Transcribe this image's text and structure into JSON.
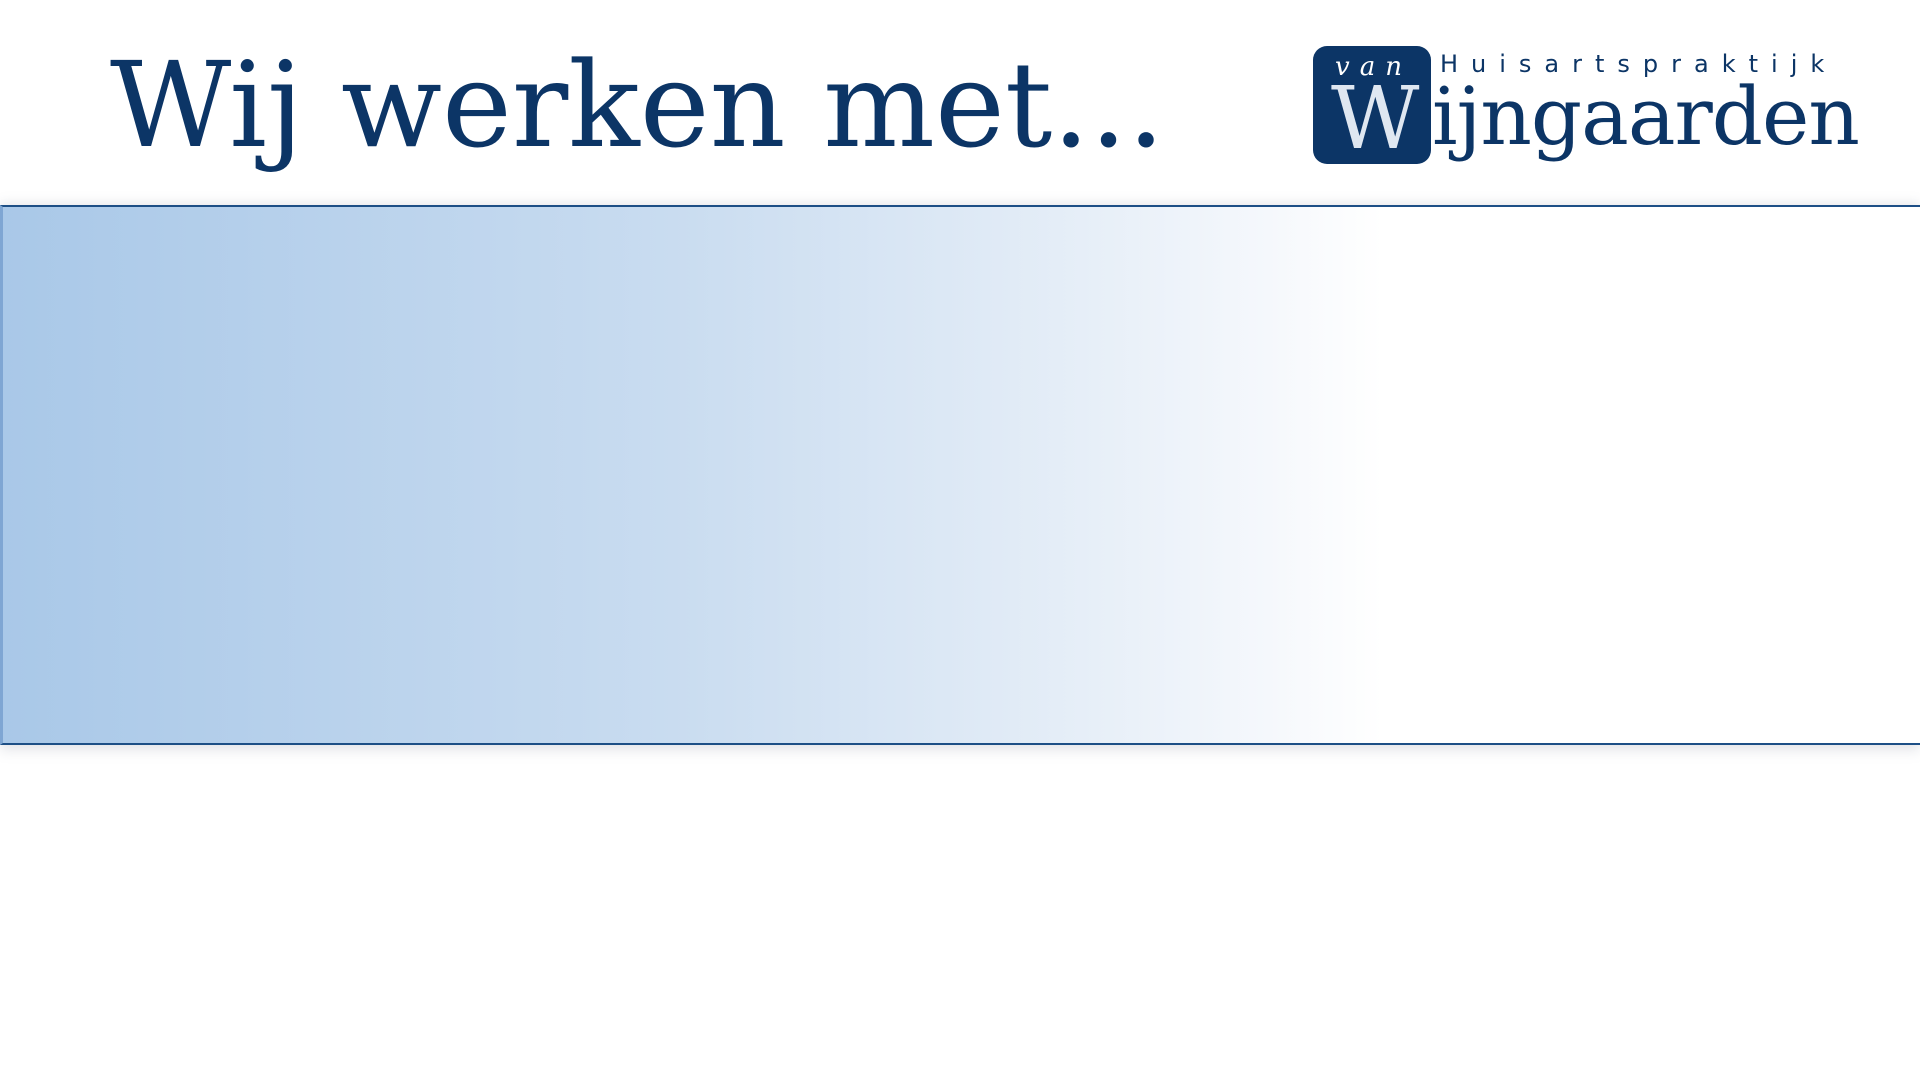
{
  "slide": {
    "title": "Wij werken met..."
  },
  "logo": {
    "prefix": "van",
    "tagline": "Huisartspraktijk",
    "initial": "W",
    "name_rest": "ijngaarden",
    "full_name": "van Wijngaarden Huisartspraktijk"
  },
  "colors": {
    "brand_navy": "#0c3566",
    "banner_light_blue": "#a9c8e8",
    "banner_border": "#1d4f86",
    "background": "#ffffff"
  }
}
